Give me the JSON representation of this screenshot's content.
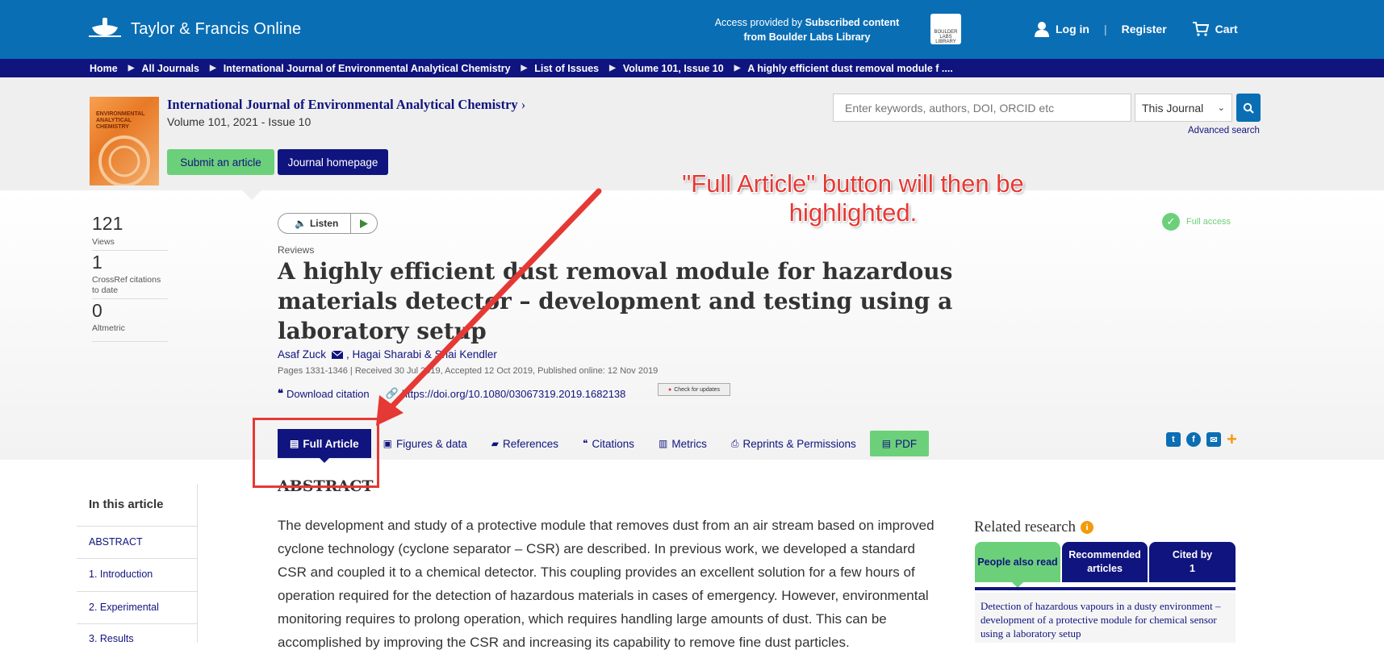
{
  "header": {
    "logo_text": "Taylor & Francis Online",
    "access_line1_prefix": "Access provided by",
    "access_line1_bold": "Subscribed content",
    "access_line2": "from Boulder Labs Library",
    "library_logo_text": "BOULDER LABS LIBRARY",
    "login": "Log in",
    "register": "Register",
    "cart": "Cart"
  },
  "breadcrumb": [
    "Home",
    "All Journals",
    "International Journal of Environmental Analytical Chemistry",
    "List of Issues",
    "Volume 101, Issue 10",
    "A highly efficient dust removal module f ...."
  ],
  "journal": {
    "title": "International Journal of Environmental Analytical Chemistry",
    "volume": "Volume 101, 2021 - Issue 10",
    "submit_label": "Submit an article",
    "homepage_label": "Journal homepage",
    "cover_text": "ENVIRONMENTAL ANALYTICAL CHEMISTRY"
  },
  "search": {
    "placeholder": "Enter keywords, authors, DOI, ORCID etc",
    "scope": "This Journal",
    "advanced": "Advanced search"
  },
  "metrics": {
    "views_value": "121",
    "views_label": "Views",
    "crossref_value": "1",
    "crossref_label": "CrossRef citations to date",
    "altmetric_value": "0",
    "altmetric_label": "Altmetric"
  },
  "article": {
    "listen_label": "Listen",
    "section": "Reviews",
    "title": "A highly efficient dust removal module for hazardous materials detector – development and testing using a laboratory setup",
    "author1": "Asaf Zuck",
    "author_rest": ", Hagai Sharabi & Shai Kendler",
    "pages": "Pages 1331-1346 | Received 30 Jul 2019, Accepted 12 Oct 2019, Published online: 12 Nov 2019",
    "download_citation": "Download citation",
    "doi": "https://doi.org/10.1080/03067319.2019.1682138",
    "check_updates": "Check for updates",
    "full_access": "Full access"
  },
  "tabs": {
    "full_article": "Full Article",
    "figures": "Figures & data",
    "references": "References",
    "citations": "Citations",
    "metrics": "Metrics",
    "reprints": "Reprints & Permissions",
    "pdf": "PDF"
  },
  "annotation": {
    "text": "\"Full Article\" button will then be highlighted."
  },
  "toc": {
    "title": "In this article",
    "items": [
      "ABSTRACT",
      "1. Introduction",
      "2. Experimental",
      "3. Results"
    ]
  },
  "abstract": {
    "heading": "ABSTRACT",
    "text": "The development and study of a protective module that removes dust from an air stream based on improved cyclone technology (cyclone separator – CSR) are described. In previous work, we developed a standard CSR and coupled it to a chemical detector. This coupling provides an excellent solution for a few hours of operation required for the detection of hazardous materials in cases of emergency. However, environmental monitoring requires to prolong operation, which requires handling large amounts of dust. This can be accomplished by improving the CSR and increasing its capability to remove fine dust particles."
  },
  "related": {
    "title": "Related research",
    "tab1": "People also read",
    "tab2": "Recommended articles",
    "tab3_line1": "Cited by",
    "tab3_line2": "1",
    "item1": "Detection of hazardous vapours in a dusty environment – development of a protective module for chemical sensor using a laboratory setup"
  },
  "colors": {
    "brand_blue": "#0a6eb4",
    "navy": "#10147e",
    "green": "#6cd07a",
    "annotation_red": "#e53935"
  }
}
